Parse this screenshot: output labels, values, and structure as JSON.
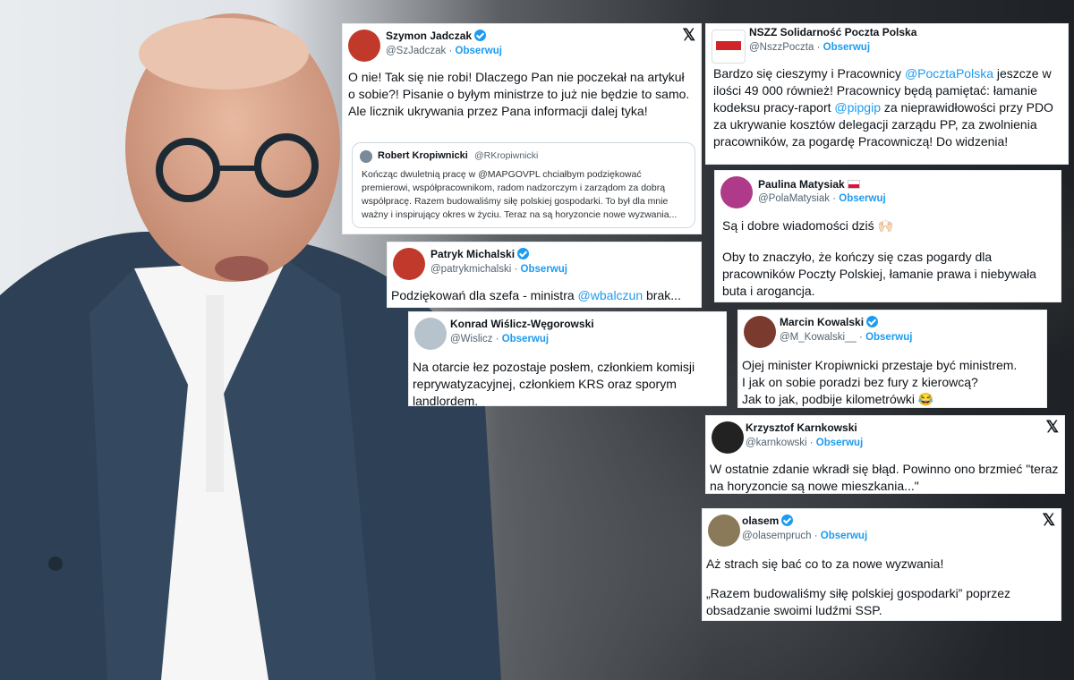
{
  "colors": {
    "accent": "#1d9bf0",
    "text": "#0f1419",
    "muted": "#536471"
  },
  "follow_label": "Obserwuj",
  "tweets": {
    "jadczak": {
      "name": "Szymon Jadczak",
      "handle": "@SzJadczak",
      "body": "O nie! Tak się nie robi! Dlaczego Pan nie poczekał na artykuł o sobie?! Pisanie o byłym ministrze to już nie będzie to samo. Ale licznik ukrywania przez Pana informacji dalej tyka!",
      "quote": {
        "name": "Robert Kropiwnicki",
        "handle": "@RKropiwnicki",
        "body": "Kończąc dwuletnią pracę w @MAPGOVPL chciałbym podziękować premierowi, współpracownikom, radom nadzorczym i zarządom za dobrą współpracę. Razem budowaliśmy siłę polskiej gospodarki. To był dla mnie ważny i inspirujący okres w życiu. Teraz na są horyzoncie nowe wyzwania..."
      }
    },
    "nszz": {
      "name": "NSZZ Solidarność Poczta Polska",
      "handle": "@NszzPoczta",
      "body_1": "Bardzo się cieszymy i Pracownicy ",
      "link_1": "@PocztaPolska",
      "body_2": " jeszcze w ilości 49 000 również! Pracownicy będą pamiętać: łamanie kodeksu pracy-raport ",
      "link_2": "@pipgip",
      "body_3": " za nieprawidłowości przy PDO za ukrywanie kosztów delegacji zarządu PP, za zwolnienia pracowników, za pogardę Pracowniczą! Do widzenia!"
    },
    "matysiak": {
      "name": "Paulina Matysiak",
      "handle": "@PolaMatysiak",
      "body_1": "Są i dobre wiadomości dziś 🙌🏻",
      "body_2": "Oby to znaczyło, że kończy się czas pogardy dla pracowników Poczty Polskiej, łamanie prawa i niebywała buta i arogancja."
    },
    "michalski": {
      "name": "Patryk Michalski",
      "handle": "@patrykmichalski",
      "body_1": "Podziękowań dla szefa - ministra ",
      "link": "@wbalczun",
      "body_2": " brak..."
    },
    "wislicz": {
      "name": "Konrad Wiślicz-Węgorowski",
      "handle": "@Wislicz",
      "body": "Na otarcie łez pozostaje posłem, członkiem komisji reprywatyzacyjnej, członkiem KRS oraz sporym landlordem."
    },
    "kowalski": {
      "name": "Marcin Kowalski",
      "handle": "@M_Kowalski__",
      "body_1": "Ojej minister Kropiwnicki przestaje być ministrem.",
      "body_2": "I jak on sobie poradzi bez fury z kierowcą?",
      "body_3": "Jak to jak, podbije kilometrówki 😂"
    },
    "karnkowski": {
      "name": "Krzysztof Karnkowski",
      "handle": "@karnkowski",
      "body": "W ostatnie zdanie wkradł się błąd. Powinno ono brzmieć \"teraz na horyzoncie są nowe mieszkania...\""
    },
    "olasem": {
      "name": "olasem",
      "handle": "@olasempruch",
      "body_1": "Aż strach się bać co to za nowe wyzwania!",
      "body_2": "„Razem budowaliśmy siłę polskiej gospodarki” poprzez obsadzanie swoimi ludźmi SSP."
    }
  },
  "x_icon": "𝕏"
}
